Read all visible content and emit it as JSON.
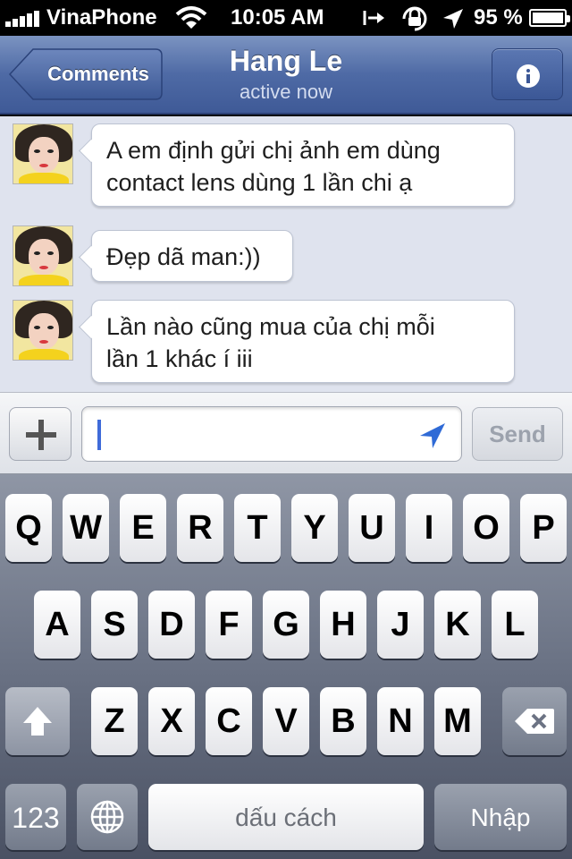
{
  "status_bar": {
    "carrier": "VinaPhone",
    "time": "10:05 AM",
    "battery_percent": "95 %",
    "battery_level": 0.95,
    "icons": [
      "signal-icon",
      "wifi-icon",
      "rotation-icon",
      "lock-icon",
      "location-arrow-icon",
      "battery-icon"
    ]
  },
  "nav": {
    "back_label": "Comments",
    "title": "Hang Le",
    "subtitle": "active now",
    "info_icon": "info-icon"
  },
  "messages": [
    {
      "line1": "A em định gửi chị ảnh em dùng",
      "line2": "contact lens dùng 1 lần chi ạ"
    },
    {
      "line1": "Đẹp dã man:))",
      "line2": ""
    },
    {
      "line1": "Lần nào cũng mua của chị mỗi",
      "line2": "lần 1 khác í iii"
    }
  ],
  "composer": {
    "input_value": "",
    "send_label": "Send",
    "add_icon": "plus-icon",
    "location_icon": "location-arrow-icon"
  },
  "keyboard": {
    "row1": [
      "Q",
      "W",
      "E",
      "R",
      "T",
      "Y",
      "U",
      "I",
      "O",
      "P"
    ],
    "row2": [
      "A",
      "S",
      "D",
      "F",
      "G",
      "H",
      "J",
      "K",
      "L"
    ],
    "row3": [
      "Z",
      "X",
      "C",
      "V",
      "B",
      "N",
      "M"
    ],
    "numbers_label": "123",
    "space_label": "dấu cách",
    "return_label": "Nhập",
    "shift_icon": "shift-icon",
    "delete_icon": "backspace-icon",
    "globe_icon": "globe-icon"
  },
  "colors": {
    "nav_bar": "#4e6aa5",
    "conversation_bg": "#dfe3ee",
    "cursor": "#3f6bd9",
    "input_arrow": "#2f6ad6"
  }
}
